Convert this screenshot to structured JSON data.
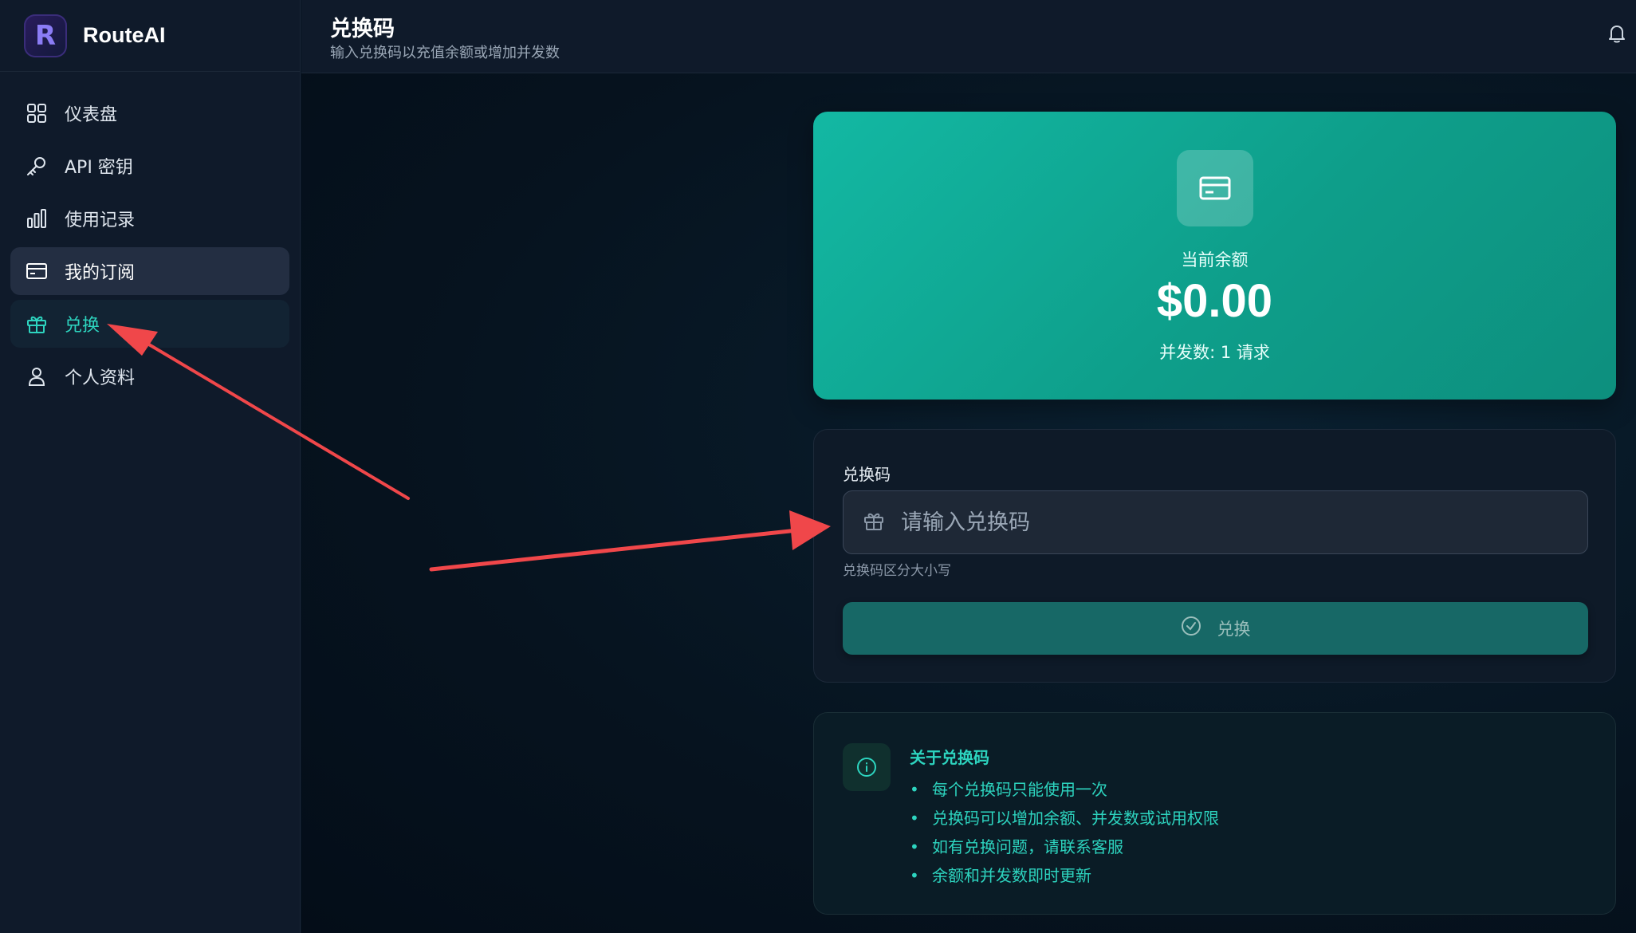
{
  "brand": {
    "name": "RouteAI",
    "logo_letter": "R"
  },
  "sidebar": {
    "items": [
      {
        "label": "仪表盘",
        "icon": "grid-icon"
      },
      {
        "label": "API 密钥",
        "icon": "key-icon"
      },
      {
        "label": "使用记录",
        "icon": "bar-chart-icon"
      },
      {
        "label": "我的订阅",
        "icon": "credit-card-icon"
      },
      {
        "label": "兑换",
        "icon": "gift-icon"
      },
      {
        "label": "个人资料",
        "icon": "user-icon"
      }
    ]
  },
  "header": {
    "title": "兑换码",
    "subtitle": "输入兑换码以充值余额或增加并发数"
  },
  "balance": {
    "label": "当前余额",
    "amount": "$0.00",
    "concurrency": "并发数: 1 请求"
  },
  "redeem": {
    "field_label": "兑换码",
    "placeholder": "请输入兑换码",
    "hint": "兑换码区分大小写",
    "button_label": "兑换"
  },
  "info": {
    "title": "关于兑换码",
    "items": [
      "每个兑换码只能使用一次",
      "兑换码可以增加余额、并发数或试用权限",
      "如有兑换问题，请联系客服",
      "余额和并发数即时更新"
    ]
  },
  "colors": {
    "accent": "#2dd4bf",
    "balance_card": "#13b8a3",
    "annotation_arrow": "#f0474a"
  }
}
